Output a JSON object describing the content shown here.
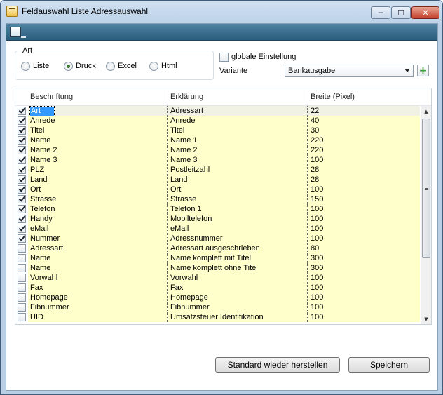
{
  "window": {
    "title": "Feldauswahl Liste Adressauswahl",
    "controls": {
      "minimize": "─",
      "maximize": "☐",
      "close": "✕"
    }
  },
  "toolbar": {
    "icon": "field-list-icon"
  },
  "art": {
    "legend": "Art",
    "options": [
      {
        "label": "Liste",
        "checked": false
      },
      {
        "label": "Druck",
        "checked": true
      },
      {
        "label": "Excel",
        "checked": false
      },
      {
        "label": "Html",
        "checked": false
      }
    ]
  },
  "global": {
    "label": "globale Einstellung",
    "checked": false
  },
  "variante": {
    "label": "Variante",
    "value": "Bankausgabe",
    "add_label": "+"
  },
  "grid": {
    "headers": [
      "Beschriftung",
      "Erklärung",
      "Breite (Pixel)"
    ],
    "rows": [
      {
        "checked": true,
        "label": "Art",
        "desc": "Adressart",
        "width": "22"
      },
      {
        "checked": true,
        "label": "Anrede",
        "desc": "Anrede",
        "width": "40"
      },
      {
        "checked": true,
        "label": "Titel",
        "desc": "Titel",
        "width": "30"
      },
      {
        "checked": true,
        "label": "Name",
        "desc": "Name 1",
        "width": "220"
      },
      {
        "checked": true,
        "label": "Name 2",
        "desc": "Name 2",
        "width": "220"
      },
      {
        "checked": true,
        "label": "Name 3",
        "desc": "Name 3",
        "width": "100"
      },
      {
        "checked": true,
        "label": "PLZ",
        "desc": "Postleitzahl",
        "width": "28"
      },
      {
        "checked": true,
        "label": "Land",
        "desc": "Land",
        "width": "28"
      },
      {
        "checked": true,
        "label": "Ort",
        "desc": "Ort",
        "width": "100"
      },
      {
        "checked": true,
        "label": "Strasse",
        "desc": "Strasse",
        "width": "150"
      },
      {
        "checked": true,
        "label": "Telefon",
        "desc": "Telefon 1",
        "width": "100"
      },
      {
        "checked": true,
        "label": "Handy",
        "desc": "Mobiltelefon",
        "width": "100"
      },
      {
        "checked": true,
        "label": "eMail",
        "desc": "eMail",
        "width": "100"
      },
      {
        "checked": true,
        "label": "Nummer",
        "desc": "Adressnummer",
        "width": "100"
      },
      {
        "checked": false,
        "label": "Adressart",
        "desc": "Adressart ausgeschrieben",
        "width": "80"
      },
      {
        "checked": false,
        "label": "Name",
        "desc": "Name komplett mit Titel",
        "width": "300"
      },
      {
        "checked": false,
        "label": "Name",
        "desc": "Name komplett ohne Titel",
        "width": "300"
      },
      {
        "checked": false,
        "label": "Vorwahl",
        "desc": "Vorwahl",
        "width": "100"
      },
      {
        "checked": false,
        "label": "Fax",
        "desc": "Fax",
        "width": "100"
      },
      {
        "checked": false,
        "label": "Homepage",
        "desc": "Homepage",
        "width": "100"
      },
      {
        "checked": false,
        "label": "Fibnummer",
        "desc": "Fibnummer",
        "width": "100"
      },
      {
        "checked": false,
        "label": "UID",
        "desc": "Umsatzsteuer Identifikation",
        "width": "100"
      }
    ]
  },
  "buttons": {
    "standard": "Standard wieder herstellen",
    "save": "Speichern"
  }
}
